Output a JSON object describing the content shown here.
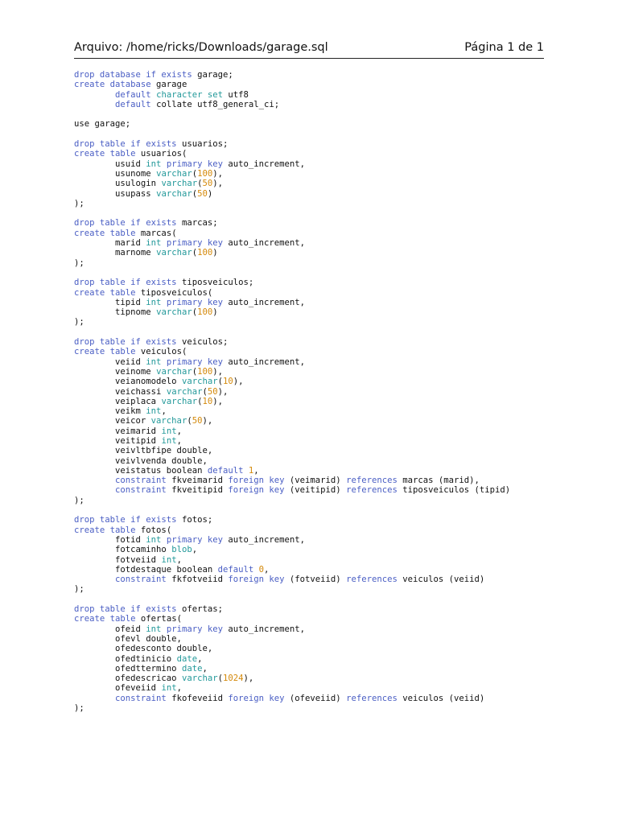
{
  "header": {
    "file_label": "Arquivo: /home/ricks/Downloads/garage.sql",
    "page_label": "Página 1 de 1"
  },
  "colors": {
    "keyword": "#4a5ec4",
    "type": "#23999a",
    "number": "#d4890a"
  },
  "code_lines": [
    [
      [
        "drop database if exists",
        "k"
      ],
      [
        " garage;",
        ""
      ]
    ],
    [
      [
        "create database",
        "k"
      ],
      [
        " garage",
        ""
      ]
    ],
    [
      [
        "        ",
        ""
      ],
      [
        "default",
        "k"
      ],
      [
        " ",
        ""
      ],
      [
        "character set",
        "t"
      ],
      [
        " utf8",
        ""
      ]
    ],
    [
      [
        "        ",
        ""
      ],
      [
        "default",
        "k"
      ],
      [
        " collate utf8_general_ci;",
        ""
      ]
    ],
    [],
    [
      [
        "use garage;",
        ""
      ]
    ],
    [],
    [
      [
        "drop table if exists",
        "k"
      ],
      [
        " usuarios;",
        ""
      ]
    ],
    [
      [
        "create table",
        "k"
      ],
      [
        " usuarios(",
        ""
      ]
    ],
    [
      [
        "        usuid ",
        ""
      ],
      [
        "int",
        "t"
      ],
      [
        " ",
        ""
      ],
      [
        "primary key",
        "k"
      ],
      [
        " auto_increment,",
        ""
      ]
    ],
    [
      [
        "        usunome ",
        ""
      ],
      [
        "varchar",
        "t"
      ],
      [
        "(",
        ""
      ],
      [
        "100",
        "n"
      ],
      [
        "),",
        ""
      ]
    ],
    [
      [
        "        usulogin ",
        ""
      ],
      [
        "varchar",
        "t"
      ],
      [
        "(",
        ""
      ],
      [
        "50",
        "n"
      ],
      [
        "),",
        ""
      ]
    ],
    [
      [
        "        usupass ",
        ""
      ],
      [
        "varchar",
        "t"
      ],
      [
        "(",
        ""
      ],
      [
        "50",
        "n"
      ],
      [
        ")",
        ""
      ]
    ],
    [
      [
        ");",
        ""
      ]
    ],
    [],
    [
      [
        "drop table if exists",
        "k"
      ],
      [
        " marcas;",
        ""
      ]
    ],
    [
      [
        "create table",
        "k"
      ],
      [
        " marcas(",
        ""
      ]
    ],
    [
      [
        "        marid ",
        ""
      ],
      [
        "int",
        "t"
      ],
      [
        " ",
        ""
      ],
      [
        "primary key",
        "k"
      ],
      [
        " auto_increment,",
        ""
      ]
    ],
    [
      [
        "        marnome ",
        ""
      ],
      [
        "varchar",
        "t"
      ],
      [
        "(",
        ""
      ],
      [
        "100",
        "n"
      ],
      [
        ")",
        ""
      ]
    ],
    [
      [
        ");",
        ""
      ]
    ],
    [],
    [
      [
        "drop table if exists",
        "k"
      ],
      [
        " tiposveiculos;",
        ""
      ]
    ],
    [
      [
        "create table",
        "k"
      ],
      [
        " tiposveiculos(",
        ""
      ]
    ],
    [
      [
        "        tipid ",
        ""
      ],
      [
        "int",
        "t"
      ],
      [
        " ",
        ""
      ],
      [
        "primary key",
        "k"
      ],
      [
        " auto_increment,",
        ""
      ]
    ],
    [
      [
        "        tipnome ",
        ""
      ],
      [
        "varchar",
        "t"
      ],
      [
        "(",
        ""
      ],
      [
        "100",
        "n"
      ],
      [
        ")",
        ""
      ]
    ],
    [
      [
        ");",
        ""
      ]
    ],
    [],
    [
      [
        "drop table if exists",
        "k"
      ],
      [
        " veiculos;",
        ""
      ]
    ],
    [
      [
        "create table",
        "k"
      ],
      [
        " veiculos(",
        ""
      ]
    ],
    [
      [
        "        veiid ",
        ""
      ],
      [
        "int",
        "t"
      ],
      [
        " ",
        ""
      ],
      [
        "primary key",
        "k"
      ],
      [
        " auto_increment,",
        ""
      ]
    ],
    [
      [
        "        veinome ",
        ""
      ],
      [
        "varchar",
        "t"
      ],
      [
        "(",
        ""
      ],
      [
        "100",
        "n"
      ],
      [
        "),",
        ""
      ]
    ],
    [
      [
        "        veianomodelo ",
        ""
      ],
      [
        "varchar",
        "t"
      ],
      [
        "(",
        ""
      ],
      [
        "10",
        "n"
      ],
      [
        "),",
        ""
      ]
    ],
    [
      [
        "        veichassi ",
        ""
      ],
      [
        "varchar",
        "t"
      ],
      [
        "(",
        ""
      ],
      [
        "50",
        "n"
      ],
      [
        "),",
        ""
      ]
    ],
    [
      [
        "        veiplaca ",
        ""
      ],
      [
        "varchar",
        "t"
      ],
      [
        "(",
        ""
      ],
      [
        "10",
        "n"
      ],
      [
        "),",
        ""
      ]
    ],
    [
      [
        "        veikm ",
        ""
      ],
      [
        "int",
        "t"
      ],
      [
        ",",
        ""
      ]
    ],
    [
      [
        "        veicor ",
        ""
      ],
      [
        "varchar",
        "t"
      ],
      [
        "(",
        ""
      ],
      [
        "50",
        "n"
      ],
      [
        "),",
        ""
      ]
    ],
    [
      [
        "        veimarid ",
        ""
      ],
      [
        "int",
        "t"
      ],
      [
        ",",
        ""
      ]
    ],
    [
      [
        "        veitipid ",
        ""
      ],
      [
        "int",
        "t"
      ],
      [
        ",",
        ""
      ]
    ],
    [
      [
        "        veivltbfipe double,",
        ""
      ]
    ],
    [
      [
        "        veivlvenda double,",
        ""
      ]
    ],
    [
      [
        "        veistatus boolean ",
        ""
      ],
      [
        "default",
        "k"
      ],
      [
        " ",
        ""
      ],
      [
        "1",
        "n"
      ],
      [
        ",",
        ""
      ]
    ],
    [
      [
        "        ",
        ""
      ],
      [
        "constraint",
        "k"
      ],
      [
        " fkveimarid ",
        ""
      ],
      [
        "foreign key",
        "k"
      ],
      [
        " (veimarid) ",
        ""
      ],
      [
        "references",
        "k"
      ],
      [
        " marcas (marid),",
        ""
      ]
    ],
    [
      [
        "        ",
        ""
      ],
      [
        "constraint",
        "k"
      ],
      [
        " fkveitipid ",
        ""
      ],
      [
        "foreign key",
        "k"
      ],
      [
        " (veitipid) ",
        ""
      ],
      [
        "references",
        "k"
      ],
      [
        " tiposveiculos (tipid)",
        ""
      ]
    ],
    [
      [
        ");",
        ""
      ]
    ],
    [],
    [
      [
        "drop table if exists",
        "k"
      ],
      [
        " fotos;",
        ""
      ]
    ],
    [
      [
        "create table",
        "k"
      ],
      [
        " fotos(",
        ""
      ]
    ],
    [
      [
        "        fotid ",
        ""
      ],
      [
        "int",
        "t"
      ],
      [
        " ",
        ""
      ],
      [
        "primary key",
        "k"
      ],
      [
        " auto_increment,",
        ""
      ]
    ],
    [
      [
        "        fotcaminho ",
        ""
      ],
      [
        "blob",
        "t"
      ],
      [
        ",",
        ""
      ]
    ],
    [
      [
        "        fotveiid ",
        ""
      ],
      [
        "int",
        "t"
      ],
      [
        ",",
        ""
      ]
    ],
    [
      [
        "        fotdestaque boolean ",
        ""
      ],
      [
        "default",
        "k"
      ],
      [
        " ",
        ""
      ],
      [
        "0",
        "n"
      ],
      [
        ",",
        ""
      ]
    ],
    [
      [
        "        ",
        ""
      ],
      [
        "constraint",
        "k"
      ],
      [
        " fkfotveiid ",
        ""
      ],
      [
        "foreign key",
        "k"
      ],
      [
        " (fotveiid) ",
        ""
      ],
      [
        "references",
        "k"
      ],
      [
        " veiculos (veiid)",
        ""
      ]
    ],
    [
      [
        ");",
        ""
      ]
    ],
    [],
    [
      [
        "drop table if exists",
        "k"
      ],
      [
        " ofertas;",
        ""
      ]
    ],
    [
      [
        "create table",
        "k"
      ],
      [
        " ofertas(",
        ""
      ]
    ],
    [
      [
        "        ofeid ",
        ""
      ],
      [
        "int",
        "t"
      ],
      [
        " ",
        ""
      ],
      [
        "primary key",
        "k"
      ],
      [
        " auto_increment,",
        ""
      ]
    ],
    [
      [
        "        ofevl double,",
        ""
      ]
    ],
    [
      [
        "        ofedesconto double,",
        ""
      ]
    ],
    [
      [
        "        ofedtinicio ",
        ""
      ],
      [
        "date",
        "t"
      ],
      [
        ",",
        ""
      ]
    ],
    [
      [
        "        ofedttermino ",
        ""
      ],
      [
        "date",
        "t"
      ],
      [
        ",",
        ""
      ]
    ],
    [
      [
        "        ofedescricao ",
        ""
      ],
      [
        "varchar",
        "t"
      ],
      [
        "(",
        ""
      ],
      [
        "1024",
        "n"
      ],
      [
        "),",
        ""
      ]
    ],
    [
      [
        "        ofeveiid ",
        ""
      ],
      [
        "int",
        "t"
      ],
      [
        ",",
        ""
      ]
    ],
    [
      [
        "        ",
        ""
      ],
      [
        "constraint",
        "k"
      ],
      [
        " fkofeveiid ",
        ""
      ],
      [
        "foreign key",
        "k"
      ],
      [
        " (ofeveiid) ",
        ""
      ],
      [
        "references",
        "k"
      ],
      [
        " veiculos (veiid)",
        ""
      ]
    ],
    [
      [
        ");",
        ""
      ]
    ]
  ]
}
